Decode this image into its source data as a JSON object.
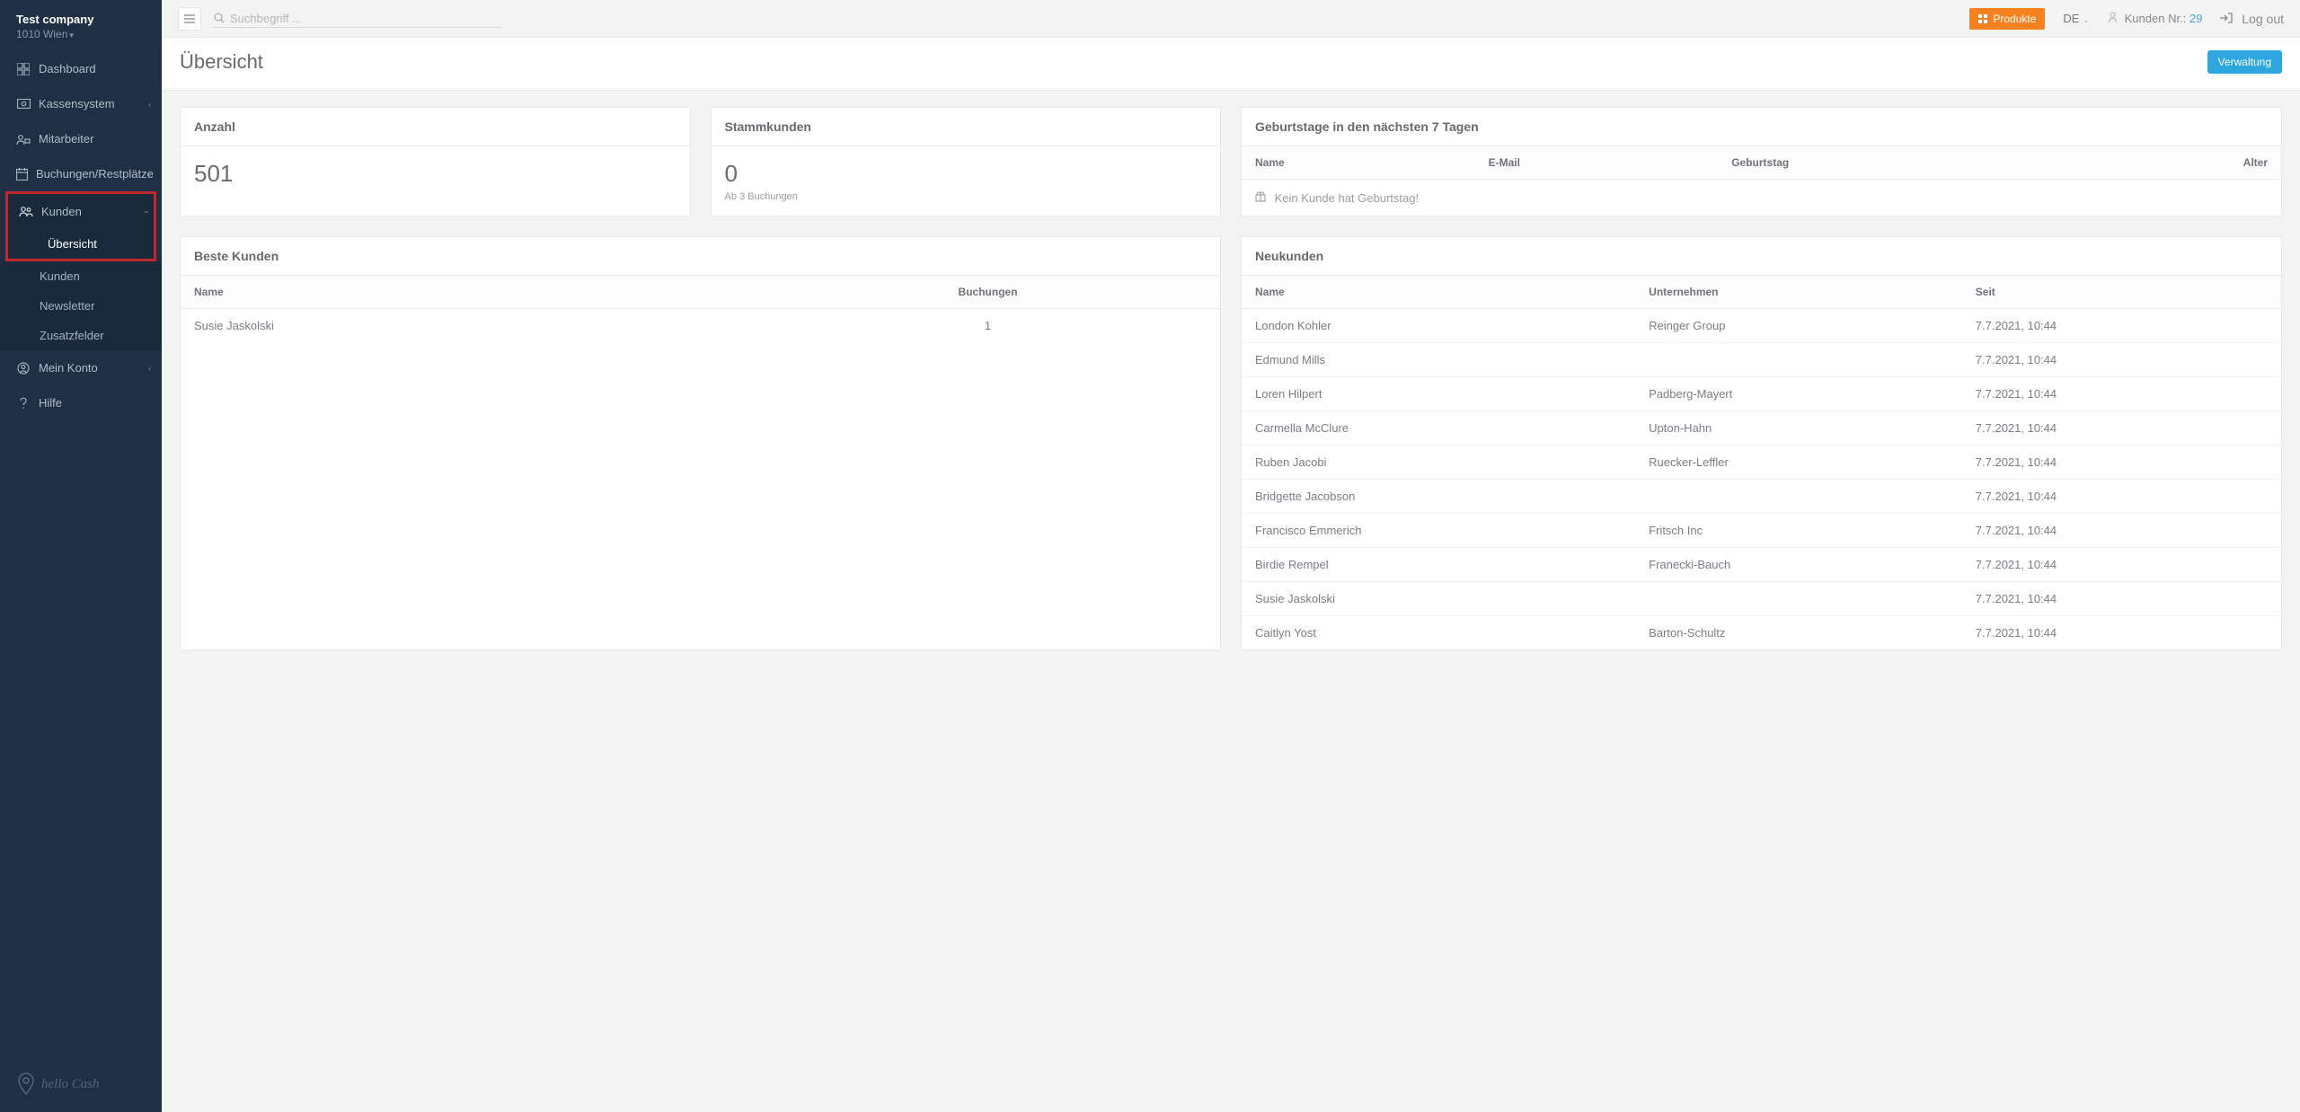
{
  "brand": {
    "name": "Test company",
    "location": "1010 Wien"
  },
  "sidebar": {
    "items": [
      {
        "label": "Dashboard"
      },
      {
        "label": "Kassensystem"
      },
      {
        "label": "Mitarbeiter"
      },
      {
        "label": "Buchungen/Restplätze"
      },
      {
        "label": "Kunden"
      },
      {
        "label": "Mein Konto"
      },
      {
        "label": "Hilfe"
      }
    ],
    "kunden_sub": [
      {
        "label": "Übersicht"
      },
      {
        "label": "Kunden"
      },
      {
        "label": "Newsletter"
      },
      {
        "label": "Zusatzfelder"
      }
    ]
  },
  "topbar": {
    "search_placeholder": "Suchbegriff ...",
    "produkte": "Produkte",
    "lang": "DE",
    "cust_label": "Kunden Nr.:",
    "cust_value": "29",
    "logout": "Log out"
  },
  "page": {
    "title": "Übersicht",
    "verwaltung": "Verwaltung"
  },
  "anzahl": {
    "title": "Anzahl",
    "value": "501"
  },
  "stammkunden": {
    "title": "Stammkunden",
    "value": "0",
    "note": "Ab 3 Buchungen"
  },
  "geburtstage": {
    "title": "Geburtstage in den nächsten 7 Tagen",
    "headers": {
      "name": "Name",
      "email": "E-Mail",
      "geb": "Geburtstag",
      "alter": "Alter"
    },
    "empty_msg": "Kein Kunde hat Geburtstag!"
  },
  "beste": {
    "title": "Beste Kunden",
    "headers": {
      "name": "Name",
      "buchungen": "Buchungen"
    },
    "rows": [
      {
        "name": "Susie Jaskolski",
        "buchungen": "1"
      }
    ]
  },
  "neukunden": {
    "title": "Neukunden",
    "headers": {
      "name": "Name",
      "unternehmen": "Unternehmen",
      "seit": "Seit"
    },
    "rows": [
      {
        "name": "London Kohler",
        "unternehmen": "Reinger Group",
        "seit": "7.7.2021, 10:44"
      },
      {
        "name": "Edmund Mills",
        "unternehmen": "",
        "seit": "7.7.2021, 10:44"
      },
      {
        "name": "Loren Hilpert",
        "unternehmen": "Padberg-Mayert",
        "seit": "7.7.2021, 10:44"
      },
      {
        "name": "Carmella McClure",
        "unternehmen": "Upton-Hahn",
        "seit": "7.7.2021, 10:44"
      },
      {
        "name": "Ruben Jacobi",
        "unternehmen": "Ruecker-Leffler",
        "seit": "7.7.2021, 10:44"
      },
      {
        "name": "Bridgette Jacobson",
        "unternehmen": "",
        "seit": "7.7.2021, 10:44"
      },
      {
        "name": "Francisco Emmerich",
        "unternehmen": "Fritsch Inc",
        "seit": "7.7.2021, 10:44"
      },
      {
        "name": "Birdie Rempel",
        "unternehmen": "Franecki-Bauch",
        "seit": "7.7.2021, 10:44"
      },
      {
        "name": "Susie Jaskolski",
        "unternehmen": "",
        "seit": "7.7.2021, 10:44"
      },
      {
        "name": "Caitlyn Yost",
        "unternehmen": "Barton-Schultz",
        "seit": "7.7.2021, 10:44"
      }
    ]
  },
  "footer_logo": "hello Cash"
}
